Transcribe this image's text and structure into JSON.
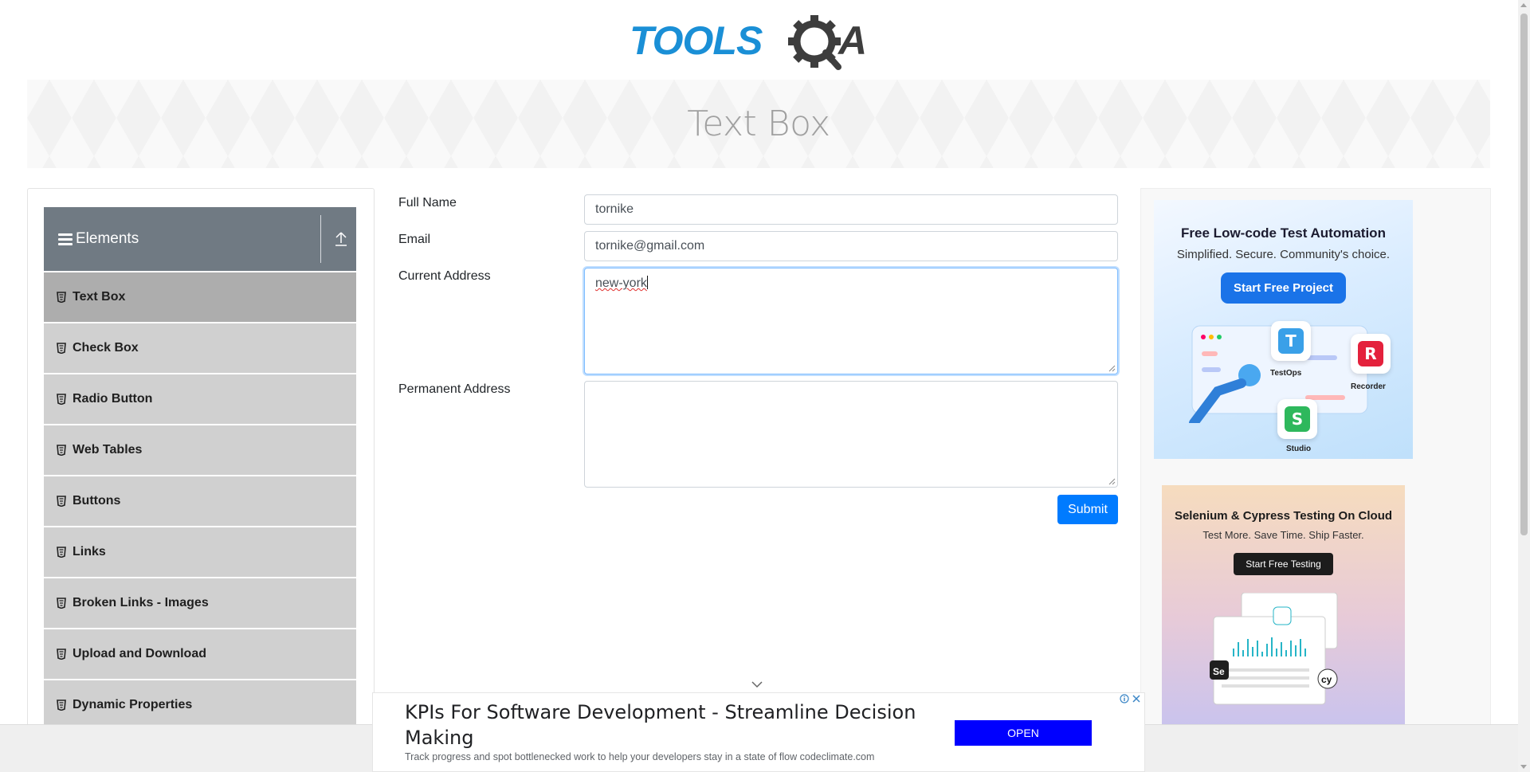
{
  "header": {
    "logo_text": "TOOLSQA"
  },
  "banner": {
    "title": "Text Box"
  },
  "sidebar": {
    "group_title": "Elements",
    "items": [
      {
        "label": "Text Box"
      },
      {
        "label": "Check Box"
      },
      {
        "label": "Radio Button"
      },
      {
        "label": "Web Tables"
      },
      {
        "label": "Buttons"
      },
      {
        "label": "Links"
      },
      {
        "label": "Broken Links - Images"
      },
      {
        "label": "Upload and Download"
      },
      {
        "label": "Dynamic Properties"
      }
    ]
  },
  "form": {
    "full_name_label": "Full Name",
    "full_name_value": "tornike",
    "email_label": "Email",
    "email_value": "tornike@gmail.com",
    "current_address_label": "Current Address",
    "current_address_value": "new-york",
    "permanent_address_label": "Permanent Address",
    "permanent_address_value": "",
    "submit_label": "Submit"
  },
  "ads": {
    "ad1": {
      "heading": "Free Low-code Test Automation",
      "subheading": "Simplified. Secure. Community's choice.",
      "button": "Start Free Project",
      "products": [
        "TestOps",
        "Recorder",
        "Studio"
      ]
    },
    "ad2": {
      "heading": "Selenium & Cypress Testing On Cloud",
      "subheading": "Test More. Save Time. Ship Faster.",
      "button": "Start Free Testing"
    },
    "bottom": {
      "title": "KPIs For Software Development - Streamline Decision Making",
      "description": "Track progress and spot bottlenecked work to help your developers stay in a state of flow codeclimate.com",
      "button": "OPEN"
    }
  },
  "colors": {
    "brand_blue": "#1a8fd6",
    "sidebar_header": "#707a83",
    "menu_item": "#d0d0d0",
    "menu_item_active": "#adadad",
    "submit": "#007bff",
    "ad_open": "#0000ff"
  }
}
